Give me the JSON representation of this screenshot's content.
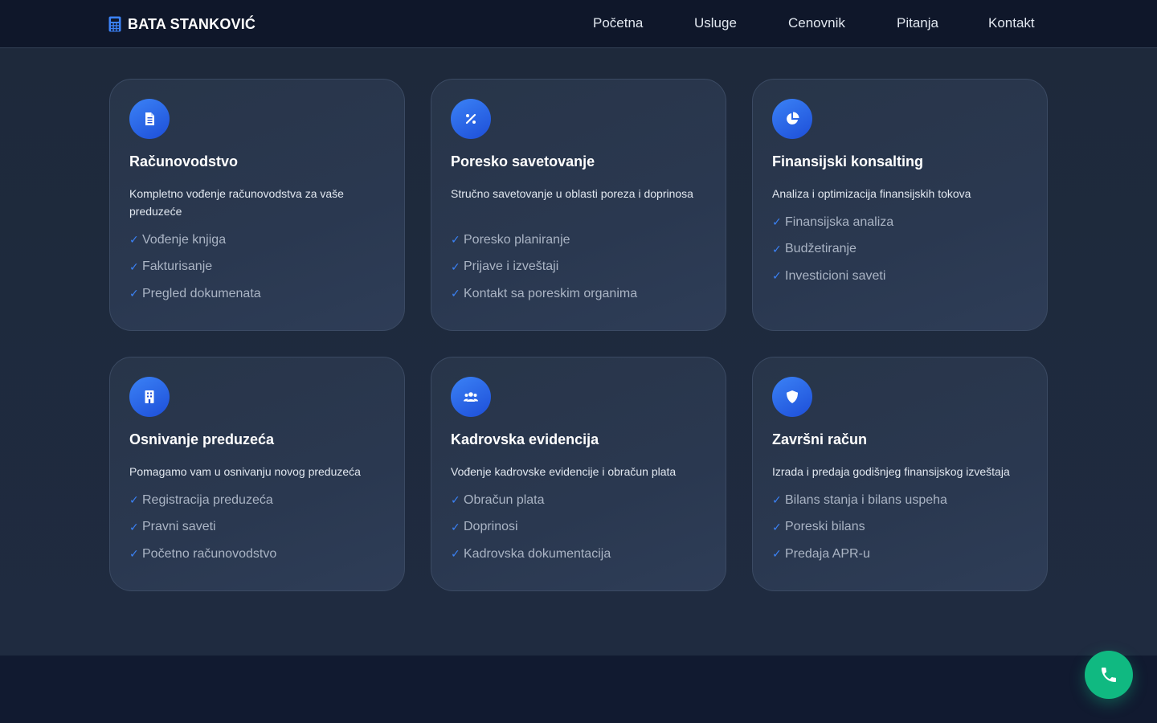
{
  "brand": {
    "name": "BATA STANKOVIĆ",
    "icon": "calculator-icon"
  },
  "nav": {
    "items": [
      "Početna",
      "Usluge",
      "Cenovnik",
      "Pitanja",
      "Kontakt"
    ]
  },
  "colors": {
    "accent": "#3b82f6",
    "navbar_bg": "#0f172a",
    "section_bg": "#1e293b",
    "call_button": "#10b981"
  },
  "services": [
    {
      "icon": "document-icon",
      "title": "Računovodstvo",
      "description": "Kompletno vođenje računovodstva za vaše preduzeće",
      "features": [
        "Vođenje knjiga",
        "Fakturisanje",
        "Pregled dokumenata"
      ]
    },
    {
      "icon": "percent-icon",
      "title": "Poresko savetovanje",
      "description": "Stručno savetovanje u oblasti poreza i doprinosa",
      "features": [
        "Poresko planiranje",
        "Prijave i izveštaji",
        "Kontakt sa poreskim organima"
      ]
    },
    {
      "icon": "pie-chart-icon",
      "title": "Finansijski konsalting",
      "description": "Analiza i optimizacija finansijskih tokova",
      "features": [
        "Finansijska analiza",
        "Budžetiranje",
        "Investicioni saveti"
      ]
    },
    {
      "icon": "building-icon",
      "title": "Osnivanje preduzeća",
      "description": "Pomagamo vam u osnivanju novog preduzeća",
      "features": [
        "Registracija preduzeća",
        "Pravni saveti",
        "Početno računovodstvo"
      ]
    },
    {
      "icon": "users-icon",
      "title": "Kadrovska evidencija",
      "description": "Vođenje kadrovske evidencije i obračun plata",
      "features": [
        "Obračun plata",
        "Doprinosi",
        "Kadrovska dokumentacija"
      ]
    },
    {
      "icon": "shield-icon",
      "title": "Završni račun",
      "description": "Izrada i predaja godišnjeg finansijskog izveštaja",
      "features": [
        "Bilans stanja i bilans uspeha",
        "Poreski bilans",
        "Predaja APR-u"
      ]
    }
  ],
  "check_mark": "✓",
  "call_button": {
    "icon": "phone-icon"
  }
}
